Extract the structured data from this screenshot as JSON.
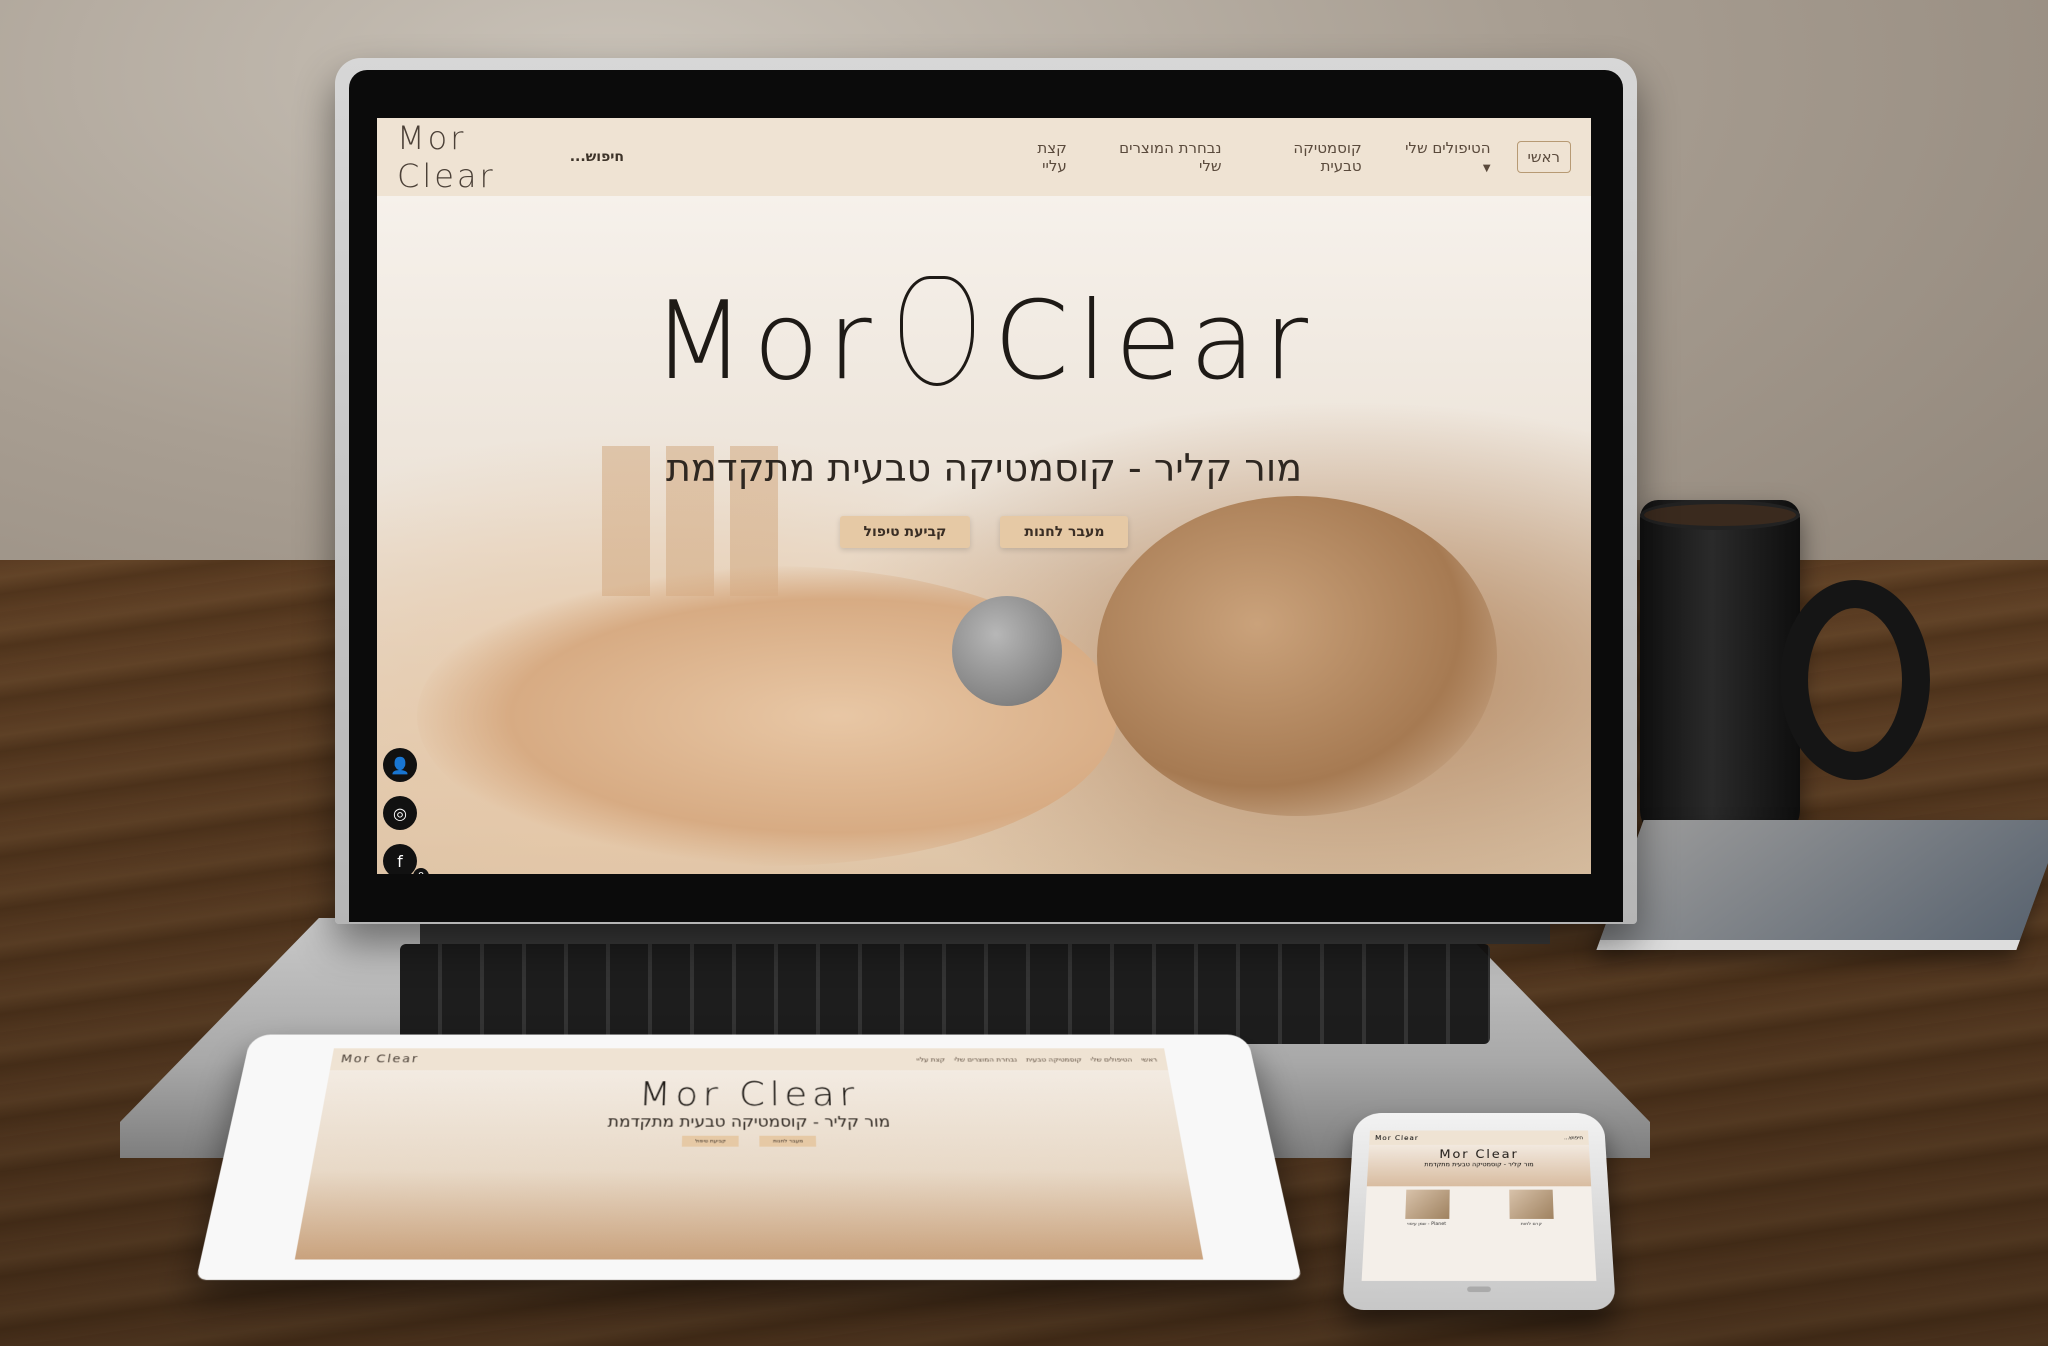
{
  "site": {
    "logo": "Mor Clear",
    "nav": {
      "home": "ראשי",
      "treatments": "הטיפולים שלי",
      "natural_cosmetics": "קוסמטיקה טבעית",
      "product_selection": "נבחרת המוצרים שלי",
      "about": "קצת עליי",
      "search": "חיפוש..."
    },
    "hero": {
      "logo_left": "Mor",
      "logo_right": "Clear",
      "tagline": "מור קליר - קוסמטיקה טבעית מתקדמת",
      "btn_shop": "מעבר לחנות",
      "btn_appointment": "קביעת טיפול"
    },
    "side_icons": [
      "user-icon",
      "instagram-icon",
      "facebook-icon",
      "cart-icon"
    ],
    "cart_count": "0"
  },
  "phone": {
    "products": [
      {
        "name": "Planet - שמן עיסוי"
      },
      {
        "name": "קרם לחות"
      }
    ]
  },
  "colors": {
    "nav_bg": "#efe3d3",
    "button_bg": "#e6c9a5",
    "text_dark": "#1e1a16"
  }
}
